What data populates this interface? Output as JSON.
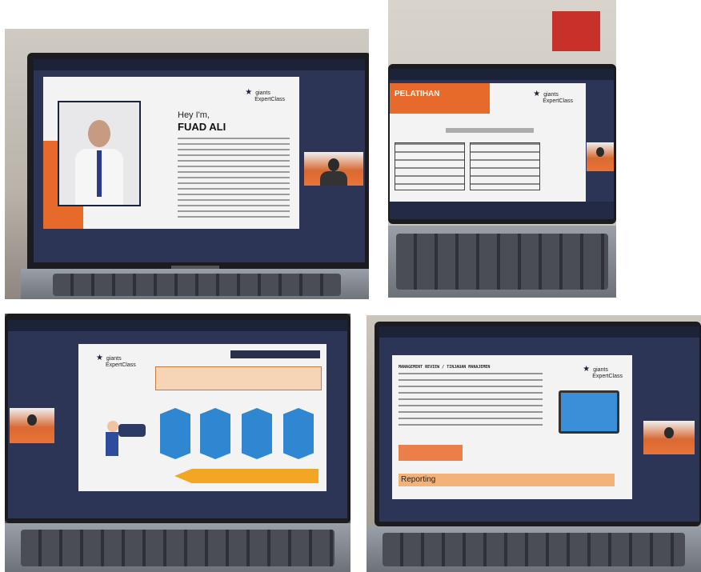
{
  "photo1": {
    "slide": {
      "greeting": "Hey I'm,",
      "name": "FUAD ALI",
      "logo_line1": "giants",
      "logo_line2": "ExpertClass"
    }
  },
  "photo2": {
    "slide": {
      "banner_title": "PELATIHAN",
      "logo_line1": "giants",
      "logo_line2": "ExpertClass"
    }
  },
  "photo3": {
    "slide": {
      "logo_line1": "giants",
      "logo_line2": "ExpertClass"
    }
  },
  "photo4": {
    "slide": {
      "heading": "MANAGEMENT REVIEW / TINJAUAN MANAJEMEN",
      "reporting_label": "Reporting",
      "logo_line1": "giants",
      "logo_line2": "ExpertClass"
    }
  }
}
